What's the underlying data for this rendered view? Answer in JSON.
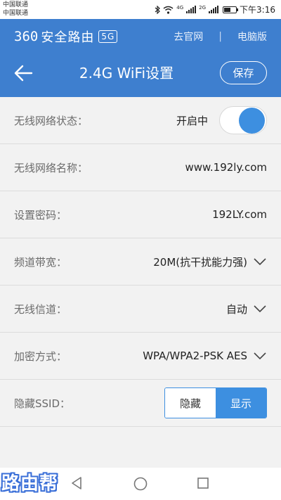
{
  "status_bar": {
    "carrier_1": "中国联通",
    "carrier_2": "中国联通",
    "net_1": "4G",
    "net_2": "2G",
    "time": "下午3:16",
    "battery_level": 0.55,
    "icons": [
      "bluetooth-icon",
      "wifi-icon",
      "signal-icon",
      "signal-icon",
      "battery-icon"
    ]
  },
  "header": {
    "brand_num": "360",
    "brand_text": "安全路由",
    "brand_badge": "5G",
    "link_official": "去官网",
    "link_separator": "|",
    "link_pc": "电脑版",
    "title": "2.4G WiFi设置",
    "save_label": "保存",
    "back_icon": "back-arrow-icon",
    "background_color": "#3e7fcf"
  },
  "settings": {
    "wireless_status": {
      "label": "无线网络状态：",
      "value": "开启中",
      "enabled": true
    },
    "ssid": {
      "label": "无线网络名称：",
      "value": "www.192ly.com"
    },
    "password": {
      "label": "设置密码：",
      "value": "192LY.com"
    },
    "bandwidth": {
      "label": "频道带宽：",
      "value": "20M(抗干扰能力强)"
    },
    "channel": {
      "label": "无线信道：",
      "value": "自动"
    },
    "encryption": {
      "label": "加密方式：",
      "value": "WPA/WPA2-PSK AES"
    },
    "hide_ssid": {
      "label": "隐藏SSID：",
      "option_hide": "隐藏",
      "option_show": "显示",
      "selected": "显示"
    }
  },
  "accent_color": "#3d8fe0",
  "watermark": "路由帮"
}
